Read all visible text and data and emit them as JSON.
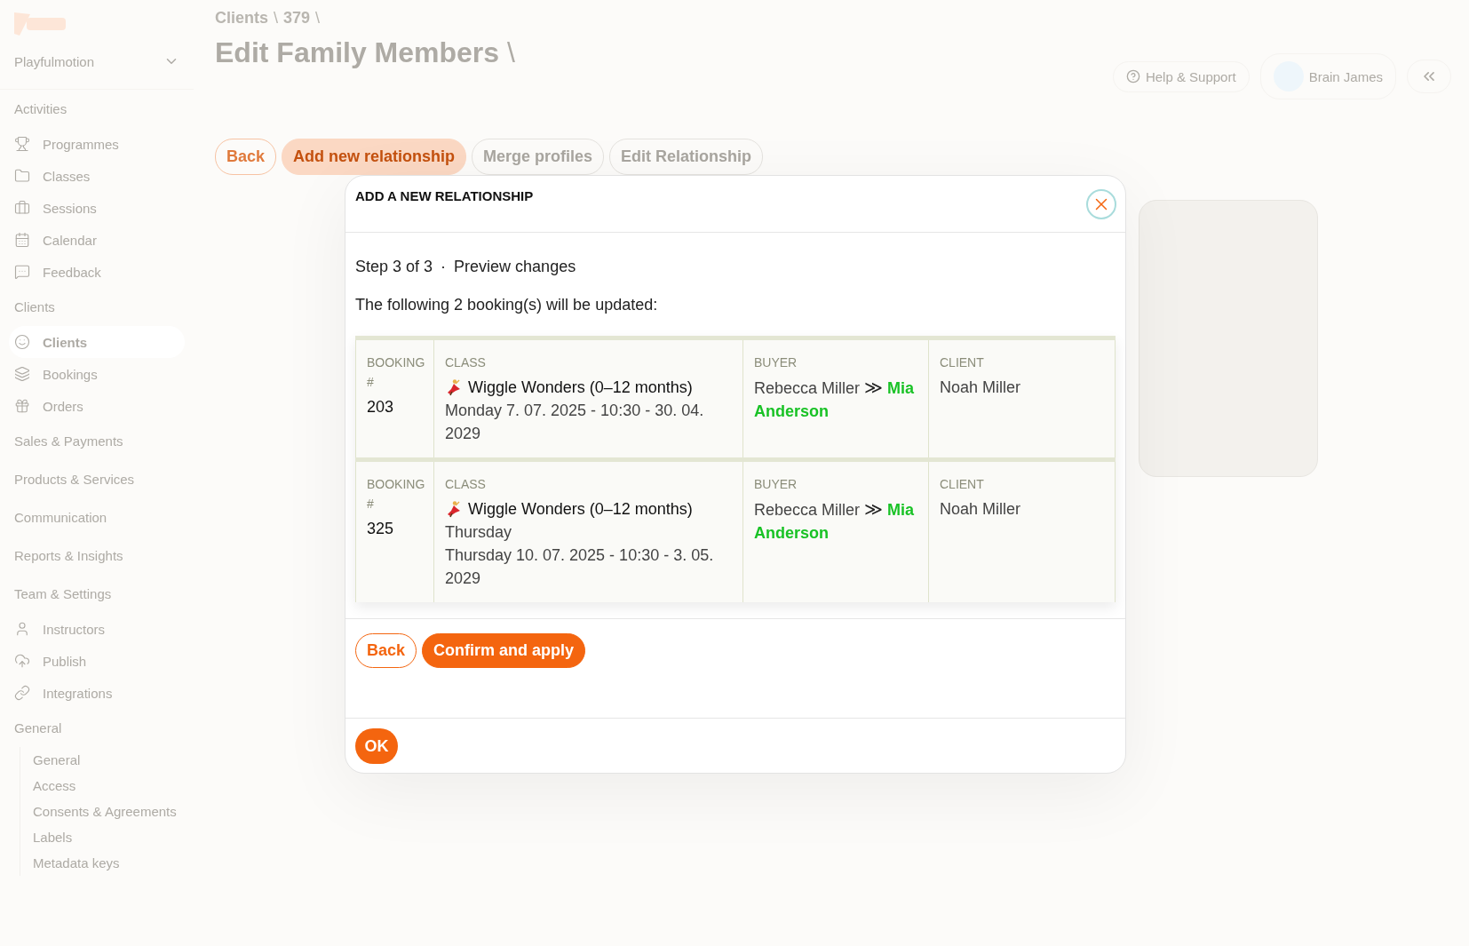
{
  "sidebar": {
    "account": "Playfulmotion",
    "sections": [
      {
        "title": "Activities",
        "items": [
          {
            "label": "Programmes",
            "selected": false
          },
          {
            "label": "Classes",
            "selected": false
          },
          {
            "label": "Sessions",
            "selected": false
          },
          {
            "label": "Calendar",
            "selected": false
          },
          {
            "label": "Feedback",
            "selected": false
          }
        ]
      },
      {
        "title": "Clients",
        "items": [
          {
            "label": "Clients",
            "selected": true
          },
          {
            "label": "Bookings",
            "selected": false
          },
          {
            "label": "Orders",
            "selected": false
          }
        ]
      },
      {
        "title": "Sales & Payments"
      },
      {
        "title": "Products & Services"
      },
      {
        "title": "Communication"
      },
      {
        "title": "Reports & Insights"
      },
      {
        "title": "Team & Settings",
        "items": [
          {
            "label": "Instructors",
            "selected": false
          },
          {
            "label": "Publish",
            "selected": false
          },
          {
            "label": "Integrations",
            "selected": false
          }
        ],
        "group": {
          "title": "General",
          "children": [
            {
              "label": "General",
              "selected": false
            },
            {
              "label": "Access",
              "selected": false
            },
            {
              "label": "Consents & Agreements",
              "selected": false
            },
            {
              "label": "Labels",
              "selected": false
            },
            {
              "label": "Metadata keys",
              "selected": false
            }
          ]
        }
      }
    ]
  },
  "header": {
    "breadcrumb": [
      "Clients",
      "379"
    ],
    "separator": "\\",
    "title": "Edit Family Members",
    "help": "Help & Support",
    "user": "Brain James"
  },
  "actions": [
    {
      "label": "Back",
      "kind": "outline-accent"
    },
    {
      "label": "Add new relationship",
      "kind": "filled"
    },
    {
      "label": "Merge profiles",
      "kind": "outline"
    },
    {
      "label": "Edit Relationship",
      "kind": "outline"
    }
  ],
  "dialog": {
    "title": "ADD A NEW RELATIONSHIP",
    "step": "Step 3 of 3",
    "step_separator": "·",
    "step_name": "Preview changes",
    "summary": "The following 2 booking(s) will be updated:",
    "rows": [
      {
        "booking_label": "BOOKING #",
        "booking": "203",
        "class_label": "CLASS",
        "class_name": "Wiggle Wonders (0–12 months)",
        "schedule": [
          "Monday 7. 07. 2025 - 10:30 - 30. 04. 2029"
        ],
        "buyer_label": "BUYER",
        "buyer_from": "Rebecca Miller",
        "buyer_arrow": "≫",
        "buyer_to": "Mia Anderson",
        "client_label": "CLIENT",
        "client": "Noah Miller"
      },
      {
        "booking_label": "BOOKING #",
        "booking": "325",
        "class_label": "CLASS",
        "class_name": "Wiggle Wonders (0–12 months)",
        "schedule": [
          "Thursday",
          "Thursday 10. 07. 2025 - 10:30 - 3. 05. 2029"
        ],
        "buyer_label": "BUYER",
        "buyer_from": "Rebecca Miller",
        "buyer_arrow": "≫",
        "buyer_to": "Mia Anderson",
        "client_label": "CLIENT",
        "client": "Noah Miller"
      }
    ],
    "buttons": [
      {
        "label": "Back",
        "kind": "outline"
      },
      {
        "label": "Confirm and apply",
        "kind": "filled"
      }
    ],
    "ok": "OK"
  }
}
